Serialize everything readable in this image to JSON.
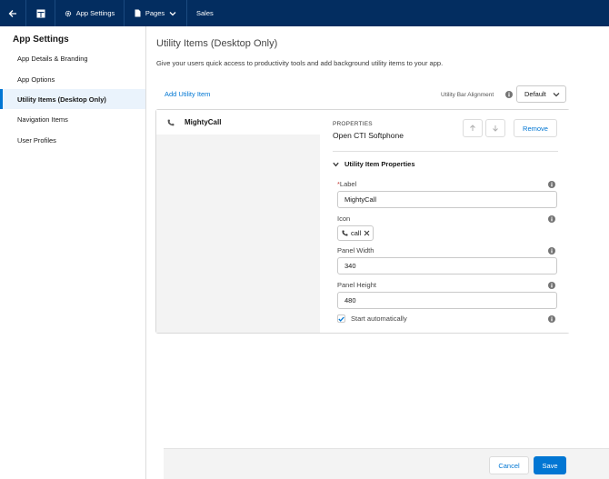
{
  "topbar": {
    "back_icon": "arrow-left-icon",
    "grid_icon": "layout-icon",
    "app_settings_label": "App Settings",
    "pages_label": "Pages",
    "sales_label": "Sales"
  },
  "sidebar": {
    "title": "App Settings",
    "items": [
      {
        "label": "App Details & Branding",
        "active": false
      },
      {
        "label": "App Options",
        "active": false
      },
      {
        "label": "Utility Items (Desktop Only)",
        "active": true
      },
      {
        "label": "Navigation Items",
        "active": false
      },
      {
        "label": "User Profiles",
        "active": false
      }
    ]
  },
  "main": {
    "title": "Utility Items (Desktop Only)",
    "description": "Give your users quick access to productivity tools and add background utility items to your app.",
    "add_item_label": "Add Utility Item",
    "alignment_label": "Utility Bar Alignment",
    "alignment_value": "Default"
  },
  "list": {
    "items": [
      {
        "label": "MightyCall",
        "icon": "phone-icon"
      }
    ]
  },
  "properties": {
    "heading": "PROPERTIES",
    "type": "Open CTI Softphone",
    "remove_label": "Remove",
    "section_title": "Utility Item Properties",
    "label_field": {
      "label": "Label",
      "required_mark": "*",
      "value": "MightyCall"
    },
    "icon_field": {
      "label": "Icon",
      "value": "call"
    },
    "panel_width": {
      "label": "Panel Width",
      "value": "340"
    },
    "panel_height": {
      "label": "Panel Height",
      "value": "480"
    },
    "start_automatically": {
      "label": "Start automatically",
      "checked": true
    }
  },
  "footer": {
    "cancel_label": "Cancel",
    "save_label": "Save"
  },
  "colors": {
    "brand_nav": "#032d60",
    "accent": "#0176d3"
  }
}
